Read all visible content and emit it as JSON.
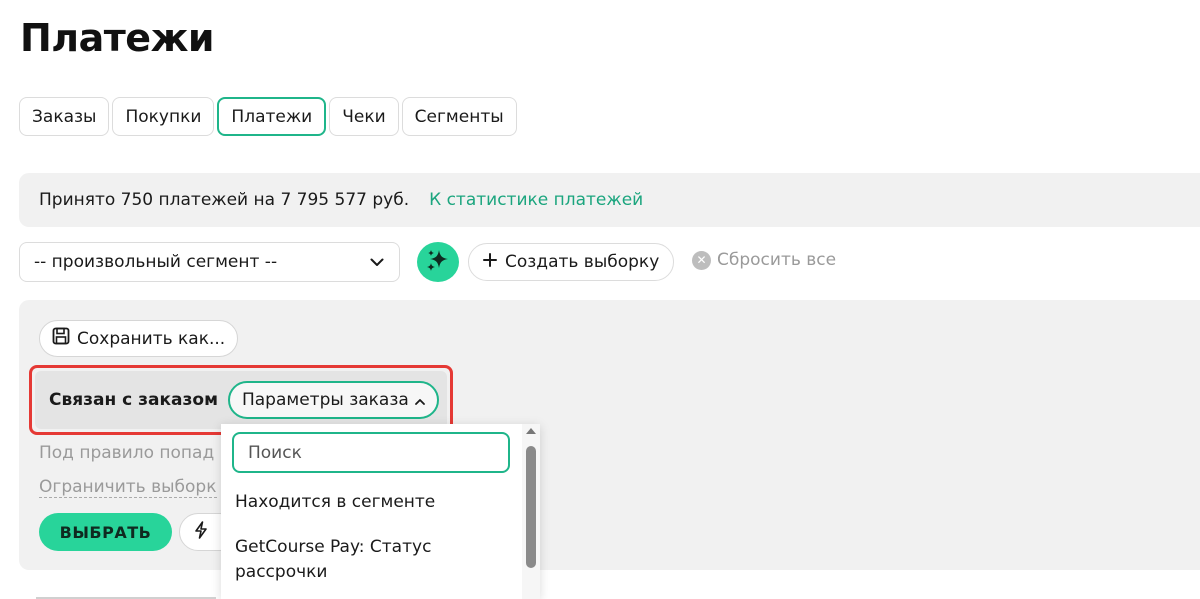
{
  "page": {
    "title": "Платежи"
  },
  "tabs": [
    {
      "label": "Заказы",
      "active": false
    },
    {
      "label": "Покупки",
      "active": false
    },
    {
      "label": "Платежи",
      "active": true
    },
    {
      "label": "Чеки",
      "active": false
    },
    {
      "label": "Сегменты",
      "active": false
    }
  ],
  "stats": {
    "text": "Принято 750 платежей на 7 795 577 руб.",
    "link": "К статистике платежей"
  },
  "toolbar": {
    "segment_value": "-- произвольный сегмент --",
    "create_label": "Создать выборку",
    "reset_label": "Сбросить все"
  },
  "filter": {
    "save_as_label": "Сохранить как...",
    "condition_label": "Связан с заказом",
    "params_label": "Параметры заказа",
    "rule_hint": "Под правило попад",
    "limit_link": "Ограничить выборк",
    "select_label": "ВЫБРАТЬ"
  },
  "dropdown": {
    "search_placeholder": "Поиск",
    "items": [
      "Находится в сегменте",
      "GetCourse Pay: Статус рассрочки"
    ]
  },
  "colors": {
    "accent": "#1fb58a",
    "accent_fill": "#28d49a",
    "highlight": "#e53935",
    "panel_bg": "#f1f1f1",
    "muted_text": "#9a9a9a"
  }
}
